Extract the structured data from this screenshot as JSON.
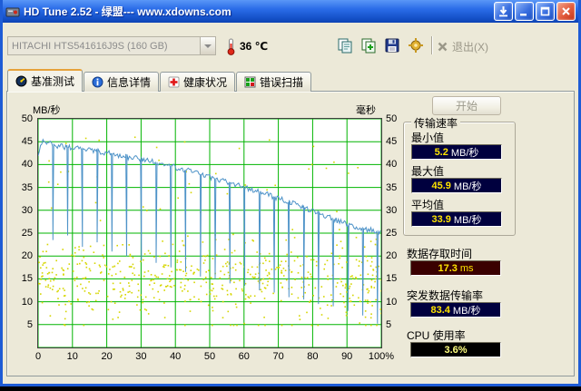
{
  "window": {
    "title": "HD Tune 2.52 - 绿盟--- www.xdowns.com"
  },
  "toolbar": {
    "drive_select": "HITACHI HTS541616J9S (160 GB)",
    "temperature": "36 ℃",
    "exit_label": "退出(X)"
  },
  "tabs": [
    {
      "label": "基准测试"
    },
    {
      "label": "信息详情"
    },
    {
      "label": "健康状况"
    },
    {
      "label": "错误扫描"
    }
  ],
  "benchmark": {
    "start_button": "开始",
    "transfer_rate": {
      "group_title": "传输速率",
      "min_label": "最小值",
      "min_value": "5.2",
      "min_unit": "MB/秒",
      "max_label": "最大值",
      "max_value": "45.9",
      "max_unit": "MB/秒",
      "avg_label": "平均值",
      "avg_value": "33.9",
      "avg_unit": "MB/秒"
    },
    "access_time": {
      "label": "数据存取时间",
      "value": "17.3",
      "unit": "ms"
    },
    "burst_rate": {
      "label": "突发数据传输率",
      "value": "83.4",
      "unit": "MB/秒"
    },
    "cpu_usage": {
      "label": "CPU 使用率",
      "value": "3.6%"
    }
  },
  "icons": {
    "titlebar": [
      "app-icon",
      "download-icon",
      "minimize-icon",
      "maximize-icon",
      "close-icon"
    ],
    "toolbar": [
      "thermometer-icon",
      "copy-image-icon",
      "copy-text-icon",
      "save-icon",
      "options-icon",
      "exit-icon"
    ],
    "tabs": [
      "gauge-icon",
      "info-icon",
      "health-cross-icon",
      "scan-grid-icon"
    ]
  },
  "colors": {
    "titlebar_blue": "#1f62e0",
    "window_bg": "#ece9d8",
    "value_box_navy": "#00003e",
    "value_box_maroon": "#3a0000",
    "value_box_black": "#000000",
    "value_yellow": "#ffe400"
  },
  "chart_data": {
    "type": "line+scatter",
    "title": "HD Tune benchmark: transfer rate (line, MB/秒) and access time dots (毫秒) vs disk position %",
    "x_axis": {
      "range": [
        0,
        100
      ],
      "ticks": [
        0,
        10,
        20,
        30,
        40,
        50,
        60,
        70,
        80,
        90,
        100
      ],
      "last_tick_label": "100%"
    },
    "y_left": {
      "label": "MB/秒",
      "range": [
        0,
        50
      ],
      "tick_step": 5
    },
    "y_right": {
      "label": "毫秒",
      "range": [
        0,
        50
      ],
      "tick_step": 5
    },
    "grid": true,
    "legend": null,
    "transfer_rate": {
      "x": [
        0,
        1.5,
        5,
        10,
        15,
        20,
        25,
        30,
        35,
        40,
        45,
        50,
        55,
        60,
        65,
        70,
        75,
        80,
        85,
        90,
        95,
        100
      ],
      "y": [
        42.5,
        45.3,
        44.2,
        43.6,
        43.2,
        42.6,
        41.8,
        41.2,
        40.4,
        39.4,
        38.4,
        37.3,
        36.2,
        35.1,
        33.9,
        32.6,
        31.3,
        29.9,
        28.4,
        26.9,
        25.9,
        25.2
      ]
    },
    "dips": [
      [
        4.3,
        23.5
      ],
      [
        8.6,
        24.5
      ],
      [
        12.9,
        22.0
      ],
      [
        17.2,
        23.0
      ],
      [
        21.5,
        21.0
      ],
      [
        25.8,
        20.0
      ],
      [
        30.1,
        19.0
      ],
      [
        34.4,
        18.5
      ],
      [
        38.7,
        17.5
      ],
      [
        43.0,
        16.5
      ],
      [
        47.3,
        15.5
      ],
      [
        51.6,
        15.0
      ],
      [
        55.9,
        14.0
      ],
      [
        60.2,
        13.5
      ],
      [
        64.5,
        12.5
      ],
      [
        68.8,
        12.0
      ],
      [
        73.1,
        11.0
      ],
      [
        77.4,
        10.5
      ],
      [
        81.7,
        9.5
      ],
      [
        86.0,
        9.0
      ],
      [
        90.3,
        8.0
      ],
      [
        94.6,
        7.0
      ],
      [
        98.9,
        5.2
      ]
    ],
    "access_time_scatter": {
      "count": 620,
      "mean": 15,
      "sd": 4.5,
      "band_min": 5,
      "band_max": 29,
      "outlier_frac": 0.06,
      "outlier_max": 47
    },
    "noise_amp": 0.6,
    "seed": 13,
    "summary": {
      "min_mbs": 5.2,
      "max_mbs": 45.9,
      "avg_mbs": 33.9,
      "access_ms": 17.3,
      "burst_mbs": 83.4,
      "cpu_pct": 3.6
    },
    "colors": {
      "line": "#4e93c8",
      "dots": "#d6d600",
      "grid": "#00b400",
      "plot_bg": "#ffffff",
      "plot_border": "#404040"
    }
  }
}
